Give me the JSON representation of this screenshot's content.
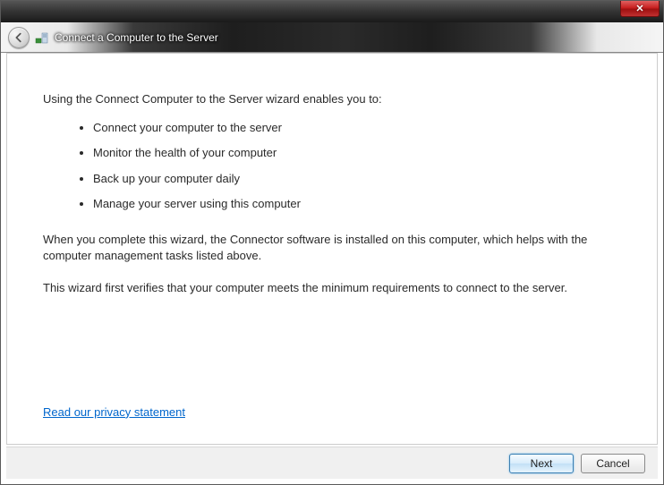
{
  "header": {
    "title": "Connect a Computer to the Server"
  },
  "body": {
    "intro": "Using the Connect Computer to the Server wizard enables you to:",
    "bullets": [
      "Connect your computer to the server",
      "Monitor the health of your computer",
      "Back up your computer daily",
      "Manage your server using this computer"
    ],
    "para1": "When you complete this wizard, the Connector software is installed on this computer, which helps with the computer management tasks listed above.",
    "para2": "This wizard first verifies that your computer meets the minimum requirements to connect to the server.",
    "privacy_link": "Read our privacy statement"
  },
  "footer": {
    "next": "Next",
    "cancel": "Cancel"
  }
}
